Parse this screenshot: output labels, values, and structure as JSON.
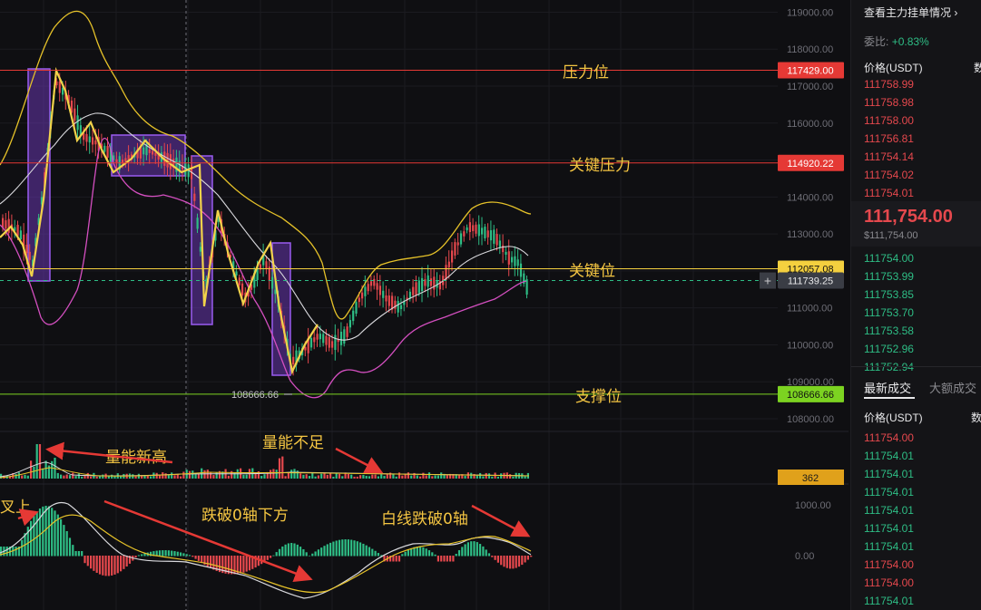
{
  "chart_data": {
    "type": "candlestick",
    "price_axis": {
      "ticks": [
        "119000.00",
        "118000.00",
        "117000.00",
        "116000.00",
        "115000.00",
        "114000.00",
        "113000.00",
        "112000.00",
        "111000.00",
        "110000.00",
        "109000.00",
        "108000.00"
      ],
      "ylim": [
        107600,
        119300
      ]
    },
    "levels": [
      {
        "value": 117429.0,
        "tag": "117429.00",
        "label": "压力位",
        "color": "#e53935"
      },
      {
        "value": 114920.22,
        "tag": "114920.22",
        "label": "关键压力",
        "color": "#e53935"
      },
      {
        "value": 112057.08,
        "tag": "112057.08",
        "label": "关键位",
        "color": "#f4d03f"
      },
      {
        "value": 108666.66,
        "tag": "108666.66",
        "label": "支撑位",
        "color": "#7cd321"
      }
    ],
    "current_price": {
      "value": 111739.25,
      "tag": "111739.25"
    },
    "low_marker": "108666.66",
    "volume": {
      "tag": "362",
      "notes": [
        "量能新高",
        "量能不足"
      ]
    },
    "macd": {
      "ticks": [
        "1000.00",
        "0.00"
      ],
      "notes": [
        "叉上",
        "跌破0轴下方",
        "白线跌破0轴"
      ]
    }
  },
  "sidebar": {
    "header_link": "查看主力挂单情况",
    "header_chevron": "chevron-right-icon",
    "wei_label": "委比:",
    "wei_value": "+0.83%",
    "col_price": "价格(USDT)",
    "col_qty": "数",
    "asks": [
      "111758.99",
      "111758.98",
      "111758.00",
      "111756.81",
      "111754.14",
      "111754.02",
      "111754.01"
    ],
    "last_price": "111,754.00",
    "last_usd": "$111,754.00",
    "bids": [
      "111754.00",
      "111753.99",
      "111753.85",
      "111753.70",
      "111753.58",
      "111752.96",
      "111752.94"
    ],
    "tab_latest": "最新成交",
    "tab_large": "大额成交",
    "trades_col_price": "价格(USDT)",
    "trades_col_qty": "数",
    "trades": [
      {
        "p": "111754.00",
        "side": "sell"
      },
      {
        "p": "111754.01",
        "side": "buy"
      },
      {
        "p": "111754.01",
        "side": "buy"
      },
      {
        "p": "111754.01",
        "side": "buy"
      },
      {
        "p": "111754.01",
        "side": "buy"
      },
      {
        "p": "111754.01",
        "side": "buy"
      },
      {
        "p": "111754.01",
        "side": "buy"
      },
      {
        "p": "111754.00",
        "side": "sell"
      },
      {
        "p": "111754.00",
        "side": "sell"
      },
      {
        "p": "111754.01",
        "side": "buy"
      }
    ]
  }
}
